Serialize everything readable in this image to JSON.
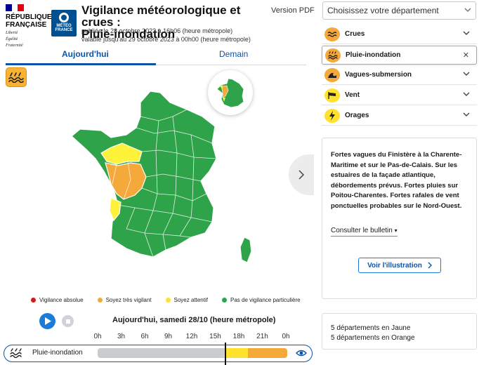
{
  "header": {
    "republic": [
      "RÉPUBLIQUE",
      "FRANÇAISE"
    ],
    "motto": [
      "Liberté",
      "Égalité",
      "Fraternité"
    ],
    "meteo_logo": [
      "MÉTÉO",
      "FRANCE"
    ],
    "title_line1": "Vigilance météorologique et crues :",
    "title_line2": "Pluie-inondation",
    "published": "publiée le 28 octobre 2023 à 16h06 (heure métropole)",
    "valid_until": "valable jusqu'au 29 octobre 2023 à 00h00 (heure métropole)",
    "pdf_link": "Version PDF"
  },
  "tabs": {
    "today": "Aujourd'hui",
    "tomorrow": "Demain",
    "active": "today"
  },
  "map": {
    "icon": "rain-flood-icon",
    "colors": {
      "green": "#2fa34a",
      "yellow": "#fff23a",
      "orange": "#f6a93b",
      "red": "#d7191c",
      "border": "#ffffff"
    }
  },
  "legend": [
    {
      "label": "Vigilance absolue",
      "color": "#d7191c"
    },
    {
      "label": "Soyez très vigilant",
      "color": "#f6a93b"
    },
    {
      "label": "Soyez attentif",
      "color": "#ffe12e"
    },
    {
      "label": "Pas de vigilance particulière",
      "color": "#2fa34a"
    }
  ],
  "timeline": {
    "date_label": "Aujourd'hui, samedi 28/10 (heure métropole)",
    "hours": [
      "0h",
      "3h",
      "6h",
      "9h",
      "12h",
      "15h",
      "18h",
      "21h",
      "0h"
    ],
    "row_label": "Pluie-inondation",
    "cursor_hour": 16.1,
    "segments": [
      {
        "from": 0,
        "to": 16,
        "color": "#c9cbce"
      },
      {
        "from": 16,
        "to": 19,
        "color": "#ffe12e"
      },
      {
        "from": 19,
        "to": 24,
        "color": "#f6a93b"
      }
    ]
  },
  "department": {
    "placeholder": "Choisissez votre département"
  },
  "risks": [
    {
      "label": "Crues",
      "icon": "flood-wave-icon",
      "color": "#f6a93b",
      "action": "chevron"
    },
    {
      "label": "Pluie-inondation",
      "icon": "rain-flood-icon",
      "color": "#f6a93b",
      "action": "close",
      "active": true
    },
    {
      "label": "Vagues-submersion",
      "icon": "wave-submersion-icon",
      "color": "#f6a93b",
      "action": "chevron"
    },
    {
      "label": "Vent",
      "icon": "wind-flag-icon",
      "color": "#ffe12e",
      "action": "chevron"
    },
    {
      "label": "Orages",
      "icon": "lightning-icon",
      "color": "#ffe12e",
      "action": "chevron"
    }
  ],
  "info": {
    "text": "Fortes vagues du Finistère à la Charente-Maritime et sur le Pas-de-Calais. Sur les estuaires de la façade atlantique, débordements prévus. Fortes pluies sur Poitou-Charentes. Fortes rafales de vent ponctuelles probables sur le Nord-Ouest.",
    "consult": "Consulter le bulletin",
    "illustration": "Voir l'illustration"
  },
  "counts": {
    "yellow": "5 départements en Jaune",
    "orange": "5 départements en Orange"
  }
}
